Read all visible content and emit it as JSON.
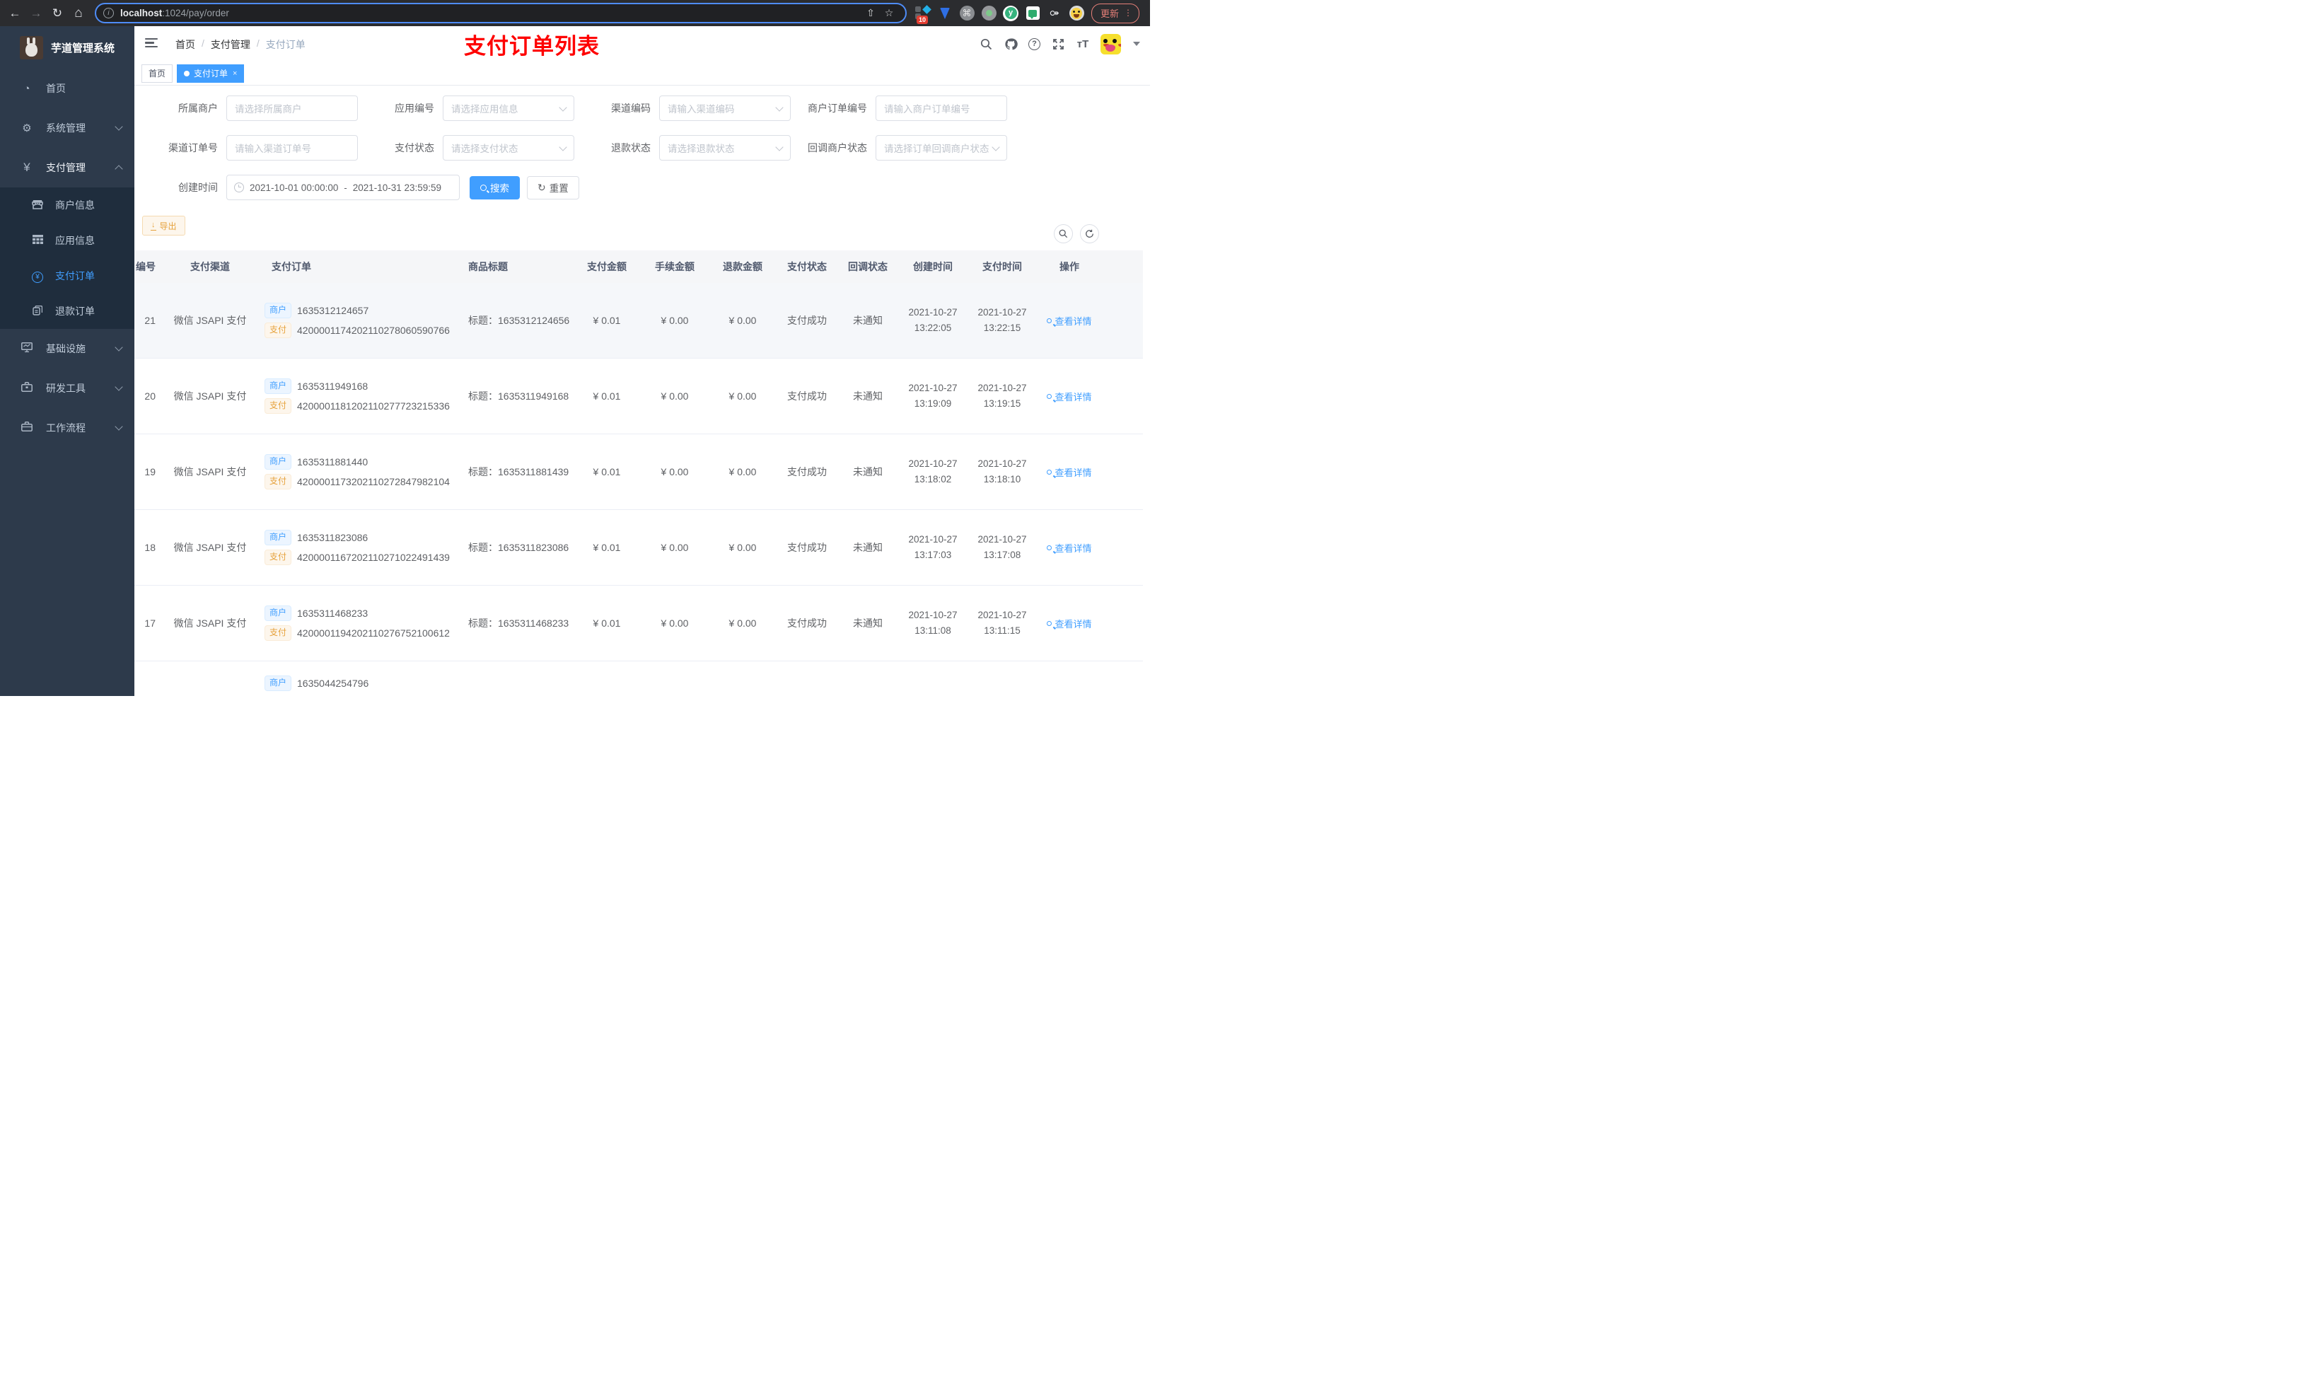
{
  "browser": {
    "url_host": "localhost",
    "url_rest": ":1024/pay/order",
    "ext_badge": "10",
    "yuque_letter": "y",
    "update_label": "更新",
    "menu_dots": "⋮",
    "cmd_glyph": "⌘",
    "puzzle_glyph": "⚩",
    "back_glyph": "←",
    "forward_glyph": "→",
    "reload_glyph": "↻",
    "home_glyph": "⌂",
    "info_glyph": "i",
    "star_glyph": "☆",
    "share_glyph": "⇧"
  },
  "sidebar": {
    "app_title": "芋道管理系统",
    "home": "首页",
    "system": "系统管理",
    "pay": "支付管理",
    "merchant_info": "商户信息",
    "app_info": "应用信息",
    "pay_order": "支付订单",
    "refund_order": "退款订单",
    "infra": "基础设施",
    "devtools": "研发工具",
    "workflow": "工作流程",
    "pay_icon": "¥",
    "gear_icon": "⚙",
    "home_icon": "◔"
  },
  "header": {
    "breadcrumb": [
      "首页",
      "支付管理",
      "支付订单"
    ],
    "separator": "/",
    "banner": "支付订单列表",
    "help_glyph": "?",
    "font_size_glyph": "тT"
  },
  "tags": {
    "home": "首页",
    "active": "支付订单",
    "close_glyph": "×"
  },
  "filters": {
    "row1": [
      {
        "label": "所属商户",
        "placeholder": "请选择所属商户"
      },
      {
        "label": "应用编号",
        "placeholder": "请选择应用信息"
      },
      {
        "label": "渠道编码",
        "placeholder": "请输入渠道编码"
      },
      {
        "label": "商户订单编号",
        "placeholder": "请输入商户订单编号"
      }
    ],
    "row2": [
      {
        "label": "渠道订单号",
        "placeholder": "请输入渠道订单号"
      },
      {
        "label": "支付状态",
        "placeholder": "请选择支付状态"
      },
      {
        "label": "退款状态",
        "placeholder": "请选择退款状态"
      },
      {
        "label": "回调商户状态",
        "placeholder": "请选择订单回调商户状态"
      }
    ],
    "date": {
      "label": "创建时间",
      "start": "2021-10-01 00:00:00",
      "sep": "-",
      "end": "2021-10-31 23:59:59"
    },
    "search_label": "搜索",
    "reset_label": "重置",
    "reset_glyph": "↻"
  },
  "toolbar": {
    "export_label": "导出",
    "export_glyph": "↓"
  },
  "table": {
    "columns": [
      "编号",
      "支付渠道",
      "支付订单",
      "商品标题",
      "支付金额",
      "手续金额",
      "退款金额",
      "支付状态",
      "回调状态",
      "创建时间",
      "支付时间",
      "操作"
    ],
    "merchant_tag": "商户",
    "pay_tag": "支付",
    "title_prefix": "标题：",
    "action_label": "查看详情",
    "rows": [
      {
        "id": "21",
        "channel": "微信 JSAPI 支付",
        "merchant_no": "1635312124657",
        "pay_no": "4200001174202110278060590766",
        "title": "1635312124656",
        "amount": "¥ 0.01",
        "fee": "¥ 0.00",
        "refund": "¥ 0.00",
        "status": "支付成功",
        "notify": "未通知",
        "create_date": "2021-10-27",
        "create_time": "13:22:05",
        "pay_date": "2021-10-27",
        "pay_time": "13:22:15"
      },
      {
        "id": "20",
        "channel": "微信 JSAPI 支付",
        "merchant_no": "1635311949168",
        "pay_no": "4200001181202110277723215336",
        "title": "1635311949168",
        "amount": "¥ 0.01",
        "fee": "¥ 0.00",
        "refund": "¥ 0.00",
        "status": "支付成功",
        "notify": "未通知",
        "create_date": "2021-10-27",
        "create_time": "13:19:09",
        "pay_date": "2021-10-27",
        "pay_time": "13:19:15"
      },
      {
        "id": "19",
        "channel": "微信 JSAPI 支付",
        "merchant_no": "1635311881440",
        "pay_no": "4200001173202110272847982104",
        "title": "1635311881439",
        "amount": "¥ 0.01",
        "fee": "¥ 0.00",
        "refund": "¥ 0.00",
        "status": "支付成功",
        "notify": "未通知",
        "create_date": "2021-10-27",
        "create_time": "13:18:02",
        "pay_date": "2021-10-27",
        "pay_time": "13:18:10"
      },
      {
        "id": "18",
        "channel": "微信 JSAPI 支付",
        "merchant_no": "1635311823086",
        "pay_no": "4200001167202110271022491439",
        "title": "1635311823086",
        "amount": "¥ 0.01",
        "fee": "¥ 0.00",
        "refund": "¥ 0.00",
        "status": "支付成功",
        "notify": "未通知",
        "create_date": "2021-10-27",
        "create_time": "13:17:03",
        "pay_date": "2021-10-27",
        "pay_time": "13:17:08"
      },
      {
        "id": "17",
        "channel": "微信 JSAPI 支付",
        "merchant_no": "1635311468233",
        "pay_no": "4200001194202110276752100612",
        "title": "1635311468233",
        "amount": "¥ 0.01",
        "fee": "¥ 0.00",
        "refund": "¥ 0.00",
        "status": "支付成功",
        "notify": "未通知",
        "create_date": "2021-10-27",
        "create_time": "13:11:08",
        "pay_date": "2021-10-27",
        "pay_time": "13:11:15"
      }
    ],
    "partial_row": {
      "merchant_no": "1635044254796"
    }
  },
  "colors": {
    "accent": "#409eff",
    "banner_red": "#fe0000",
    "warning": "#e6a23c",
    "sidebar_bg": "#2d3a4b",
    "submenu_bg": "#1f2d3d"
  }
}
